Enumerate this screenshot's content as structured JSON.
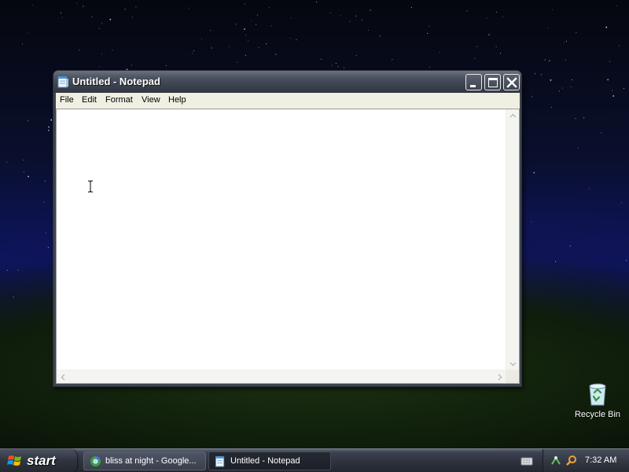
{
  "desktop": {
    "recycle_bin_label": "Recycle Bin"
  },
  "notepad": {
    "title": "Untitled - Notepad",
    "menu": [
      "File",
      "Edit",
      "Format",
      "View",
      "Help"
    ],
    "content": ""
  },
  "taskbar": {
    "start_label": "start",
    "tasks": [
      {
        "label": "bliss at night - Google...",
        "icon": "chrome-icon",
        "active": false
      },
      {
        "label": "Untitled - Notepad",
        "icon": "notepad-icon",
        "active": true
      }
    ],
    "clock": "7:32 AM"
  },
  "colors": {
    "title_bar": "#3d4350",
    "taskbar": "#2c313c",
    "menu_bar": "#f1efe2",
    "sky": "#0d1560",
    "hill": "#1c3312"
  }
}
